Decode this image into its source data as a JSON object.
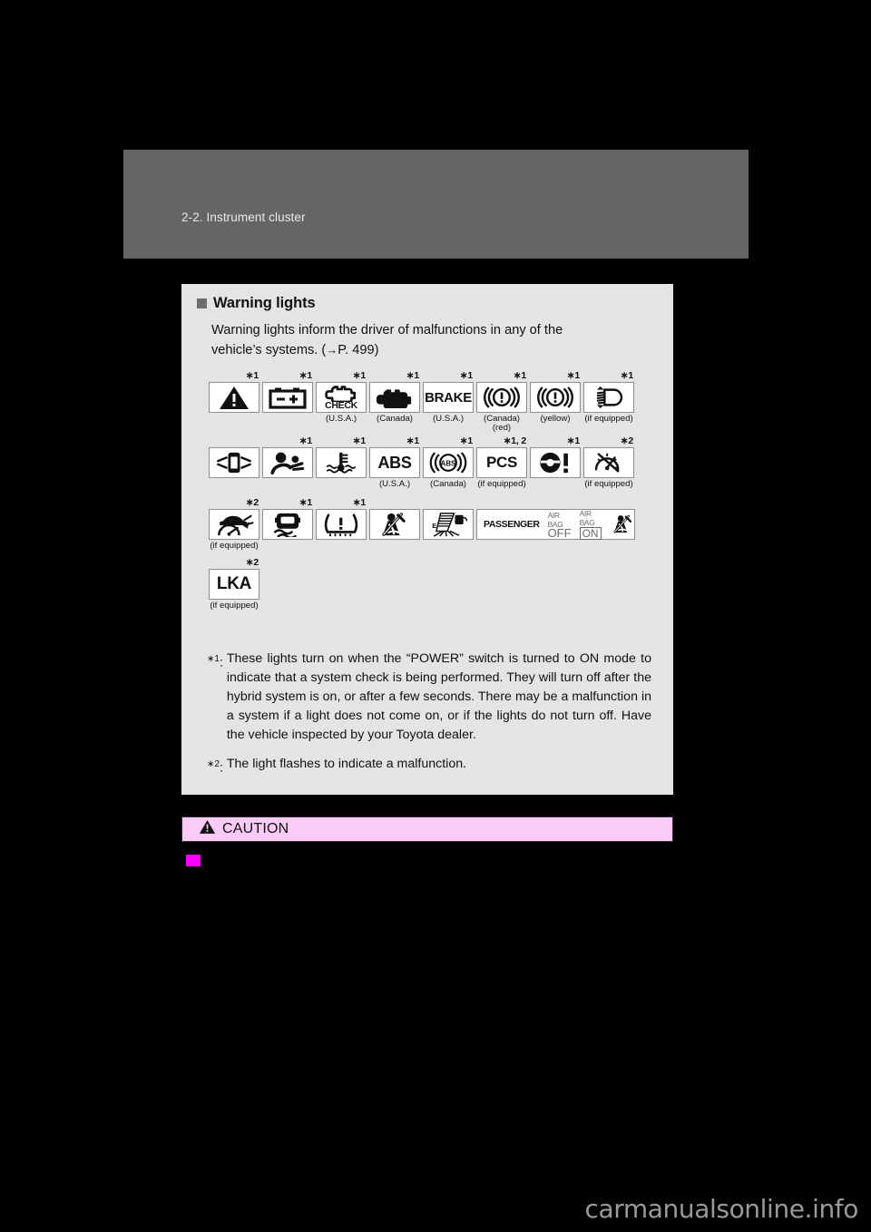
{
  "header": {
    "title": "2-2. Instrument cluster"
  },
  "section": {
    "bullet_icon": "square-bullet-icon",
    "title": "Warning lights",
    "intro_line1": "Warning lights inform the driver of malfunctions in any of the",
    "intro_line2_pre": "vehicle’s systems. (",
    "intro_arrow": "→",
    "intro_page": "P. 499",
    "intro_line2_post": ")"
  },
  "icon_rows": [
    {
      "row": 1,
      "cells": [
        {
          "icon": "master-warning-triangle-icon",
          "star": "∗1",
          "caption": ""
        },
        {
          "icon": "battery-charge-warning-icon",
          "star": "∗1",
          "caption": ""
        },
        {
          "icon": "check-engine-usa-icon",
          "star": "∗1",
          "caption": "(U.S.A.)"
        },
        {
          "icon": "check-engine-canada-icon",
          "star": "∗1",
          "caption": "(Canada)"
        },
        {
          "icon": "brake-warning-text-icon",
          "star": "∗1",
          "caption": "(U.S.A.)"
        },
        {
          "icon": "brake-warning-circle-red-icon",
          "star": "∗1",
          "caption": "(Canada)\n(red)"
        },
        {
          "icon": "brake-warning-circle-yellow-icon",
          "star": "∗1",
          "caption": "(yellow)"
        },
        {
          "icon": "headlight-malfunction-icon",
          "star": "∗1",
          "caption": "(if equipped)"
        }
      ]
    },
    {
      "row": 2,
      "cells": [
        {
          "icon": "door-ajar-icon",
          "star": "",
          "caption": ""
        },
        {
          "icon": "srs-airbag-warning-icon",
          "star": "∗1",
          "caption": ""
        },
        {
          "icon": "engine-coolant-temperature-icon",
          "star": "∗1",
          "caption": ""
        },
        {
          "icon": "abs-text-icon",
          "star": "∗1",
          "caption": "(U.S.A.)"
        },
        {
          "icon": "abs-circle-icon",
          "star": "∗1",
          "caption": "(Canada)"
        },
        {
          "icon": "pcs-warning-icon",
          "star": "∗1, 2",
          "caption": "(if equipped)"
        },
        {
          "icon": "electric-power-steering-icon",
          "star": "∗1",
          "caption": ""
        },
        {
          "icon": "radar-cruise-control-icon",
          "star": "∗2",
          "caption": "(if equipped)"
        }
      ]
    },
    {
      "row": 3,
      "cells": [
        {
          "icon": "dynamic-radar-cruise-malfunction-icon",
          "star": "∗2",
          "caption": "(if equipped)"
        },
        {
          "icon": "slip-indicator-icon",
          "star": "∗1",
          "caption": ""
        },
        {
          "icon": "tire-pressure-warning-icon",
          "star": "∗1",
          "caption": ""
        },
        {
          "icon": "seat-belt-reminder-icon",
          "star": "",
          "caption": ""
        },
        {
          "icon": "low-fuel-level-icon",
          "star": "",
          "caption": ""
        },
        {
          "icon": "passenger-airbag-onoff-icon",
          "star": "",
          "caption": ""
        }
      ]
    },
    {
      "row": 4,
      "cells": [
        {
          "icon": "lka-text-icon",
          "star": "∗2",
          "caption": "(if equipped)"
        }
      ]
    }
  ],
  "airbag_panel": {
    "passenger_label": "PASSENGER",
    "off_top": "AIR BAG",
    "off_bottom": "OFF",
    "on_top": "AIR BAG",
    "on_bottom": "ON",
    "belt_icon": "seat-belt-reminder-icon"
  },
  "text_icons": {
    "check": "CHECK",
    "brake": "BRAKE",
    "abs": "ABS",
    "abs_small": "ABS",
    "pcs": "PCS",
    "lka": "LKA",
    "fuel_e": "E"
  },
  "notes": [
    {
      "mark_star": "∗",
      "mark_num": "1",
      "mark_colon": ":",
      "text": "These lights turn on when the “POWER” switch is turned to ON mode to indicate that a system check is being performed. They will turn off after the hybrid system is on, or after a few seconds. There may be a malfunction in a system if a light does not come on, or if the lights do not turn off. Have the vehicle inspected by your Toyota dealer."
    },
    {
      "mark_star": "∗",
      "mark_num": "2",
      "mark_colon": ":",
      "text": "The light flashes to indicate a malfunction."
    }
  ],
  "caution": {
    "icon": "warning-triangle-icon",
    "label": "CAUTION"
  },
  "watermark": {
    "text": "carmanualsonline.info"
  },
  "colors": {
    "page_background": "#000000",
    "header_bar": "#656565",
    "content_panel": "#e4e4e4",
    "caution_bar": "#fbcbf7",
    "magenta_marker": "#ff00ff",
    "icon_box": "#ffffff",
    "text": "#111111"
  }
}
